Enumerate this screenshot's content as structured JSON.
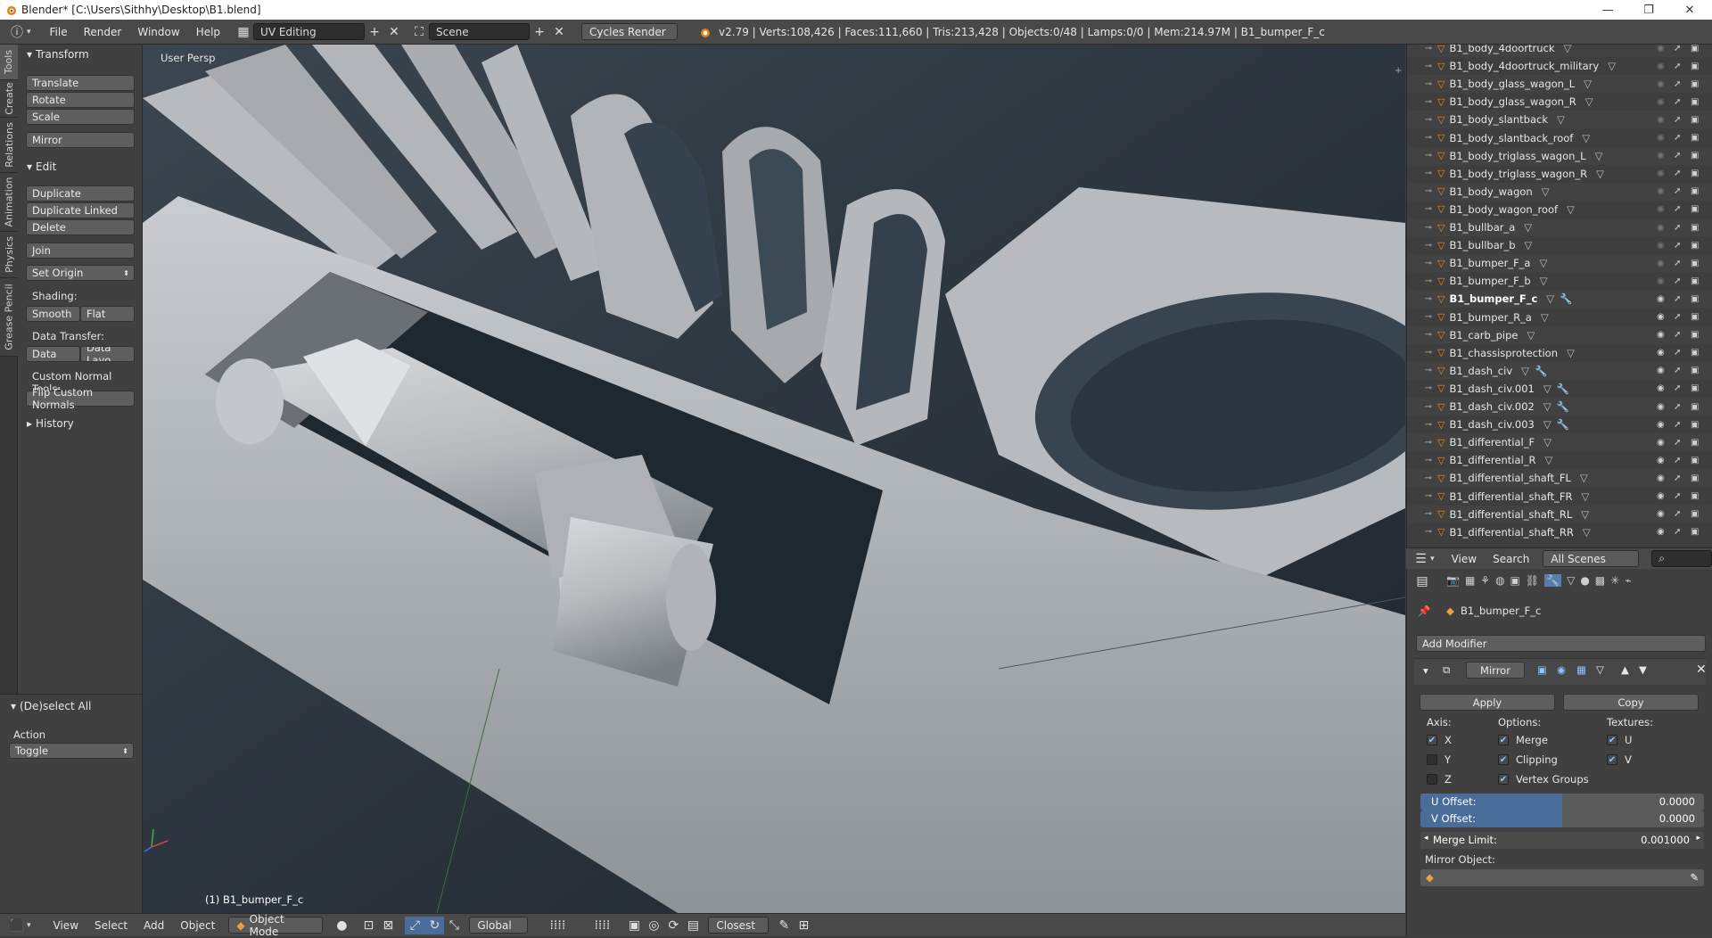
{
  "window": {
    "title": "Blender* [C:\\Users\\Sithhy\\Desktop\\B1.blend]"
  },
  "info_header": {
    "menus": [
      "File",
      "Render",
      "Window",
      "Help"
    ],
    "layout": "UV Editing",
    "scene": "Scene",
    "engine": "Cycles Render",
    "stats": "v2.79 | Verts:108,426 | Faces:111,660 | Tris:213,428 | Objects:0/48 | Lamps:0/0 | Mem:214.97M | B1_bumper_F_c"
  },
  "tabs": [
    "Tools",
    "Create",
    "Relations",
    "Animation",
    "Physics",
    "Grease Pencil"
  ],
  "tools": {
    "transform_header": "Transform",
    "translate": "Translate",
    "rotate": "Rotate",
    "scale": "Scale",
    "mirror": "Mirror",
    "edit_header": "Edit",
    "duplicate": "Duplicate",
    "duplicate_linked": "Duplicate Linked",
    "delete": "Delete",
    "join": "Join",
    "set_origin": "Set Origin",
    "shading_label": "Shading:",
    "smooth": "Smooth",
    "flat": "Flat",
    "data_transfer_label": "Data Transfer:",
    "data": "Data",
    "data_layout": "Data Layo",
    "custom_normal_label": "Custom Normal Tools:",
    "flip_custom_normals": "Flip Custom Normals",
    "history_header": "History"
  },
  "operator": {
    "title": "(De)select All",
    "action_label": "Action",
    "action_value": "Toggle"
  },
  "viewport": {
    "view_label": "User Persp",
    "object_label": "(1) B1_bumper_F_c"
  },
  "bottom_bar": {
    "menus": [
      "View",
      "Select",
      "Add",
      "Object"
    ],
    "mode": "Object Mode",
    "orientation": "Global",
    "snap": "Closest"
  },
  "outliner": {
    "items": [
      "B1_body_4doortruck",
      "B1_body_4doortruck_military",
      "B1_body_glass_wagon_L",
      "B1_body_glass_wagon_R",
      "B1_body_slantback",
      "B1_body_slantback_roof",
      "B1_body_triglass_wagon_L",
      "B1_body_triglass_wagon_R",
      "B1_body_wagon",
      "B1_body_wagon_roof",
      "B1_bullbar_a",
      "B1_bullbar_b",
      "B1_bumper_F_a",
      "B1_bumper_F_b",
      "B1_bumper_F_c",
      "B1_bumper_R_a",
      "B1_carb_pipe",
      "B1_chassisprotection",
      "B1_dash_civ",
      "B1_dash_civ.001",
      "B1_dash_civ.002",
      "B1_dash_civ.003",
      "B1_differential_F",
      "B1_differential_R",
      "B1_differential_shaft_FL",
      "B1_differential_shaft_FR",
      "B1_differential_shaft_RL",
      "B1_differential_shaft_RR"
    ],
    "header_menus": [
      "View",
      "Search"
    ],
    "filter": "All Scenes"
  },
  "properties": {
    "object_name": "B1_bumper_F_c",
    "add_modifier": "Add Modifier",
    "modifier_name": "Mirror",
    "apply": "Apply",
    "copy": "Copy",
    "axis_label": "Axis:",
    "options_label": "Options:",
    "textures_label": "Textures:",
    "x": "X",
    "y": "Y",
    "z": "Z",
    "merge": "Merge",
    "clipping": "Clipping",
    "vertex_groups": "Vertex Groups",
    "u": "U",
    "v": "V",
    "u_offset_label": "U Offset:",
    "u_offset": "0.0000",
    "v_offset_label": "V Offset:",
    "v_offset": "0.0000",
    "merge_limit_label": "Merge Limit:",
    "merge_limit": "0.001000",
    "mirror_object_label": "Mirror Object:"
  }
}
